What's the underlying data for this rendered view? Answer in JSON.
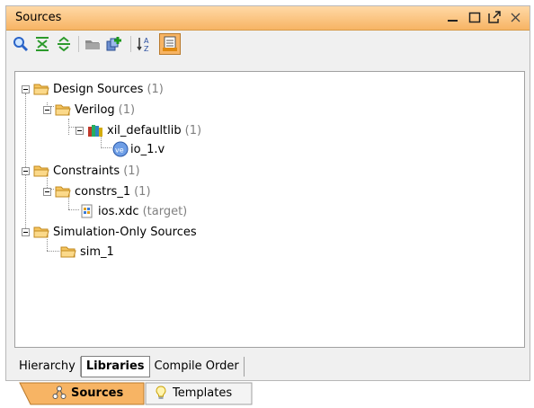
{
  "window": {
    "title": "Sources"
  },
  "tree": {
    "items": [
      {
        "label": "Design Sources",
        "count": "(1)"
      },
      {
        "label": "Verilog",
        "count": "(1)"
      },
      {
        "label": "xil_defaultlib",
        "count": "(1)"
      },
      {
        "label": "io_1.v",
        "count": ""
      },
      {
        "label": "Constraints",
        "count": "(1)"
      },
      {
        "label": "constrs_1",
        "count": "(1)"
      },
      {
        "label": "ios.xdc",
        "count": "(target)"
      },
      {
        "label": "Simulation-Only Sources",
        "count": ""
      },
      {
        "label": "sim_1",
        "count": ""
      }
    ]
  },
  "subtabs": [
    "Hierarchy",
    "Libraries",
    "Compile Order"
  ],
  "bottom_tabs": [
    "Sources",
    "Templates"
  ],
  "colors": {
    "title_bar": "#f7b464",
    "folder": "#f5c45e",
    "active_tool": "#f7b464"
  }
}
